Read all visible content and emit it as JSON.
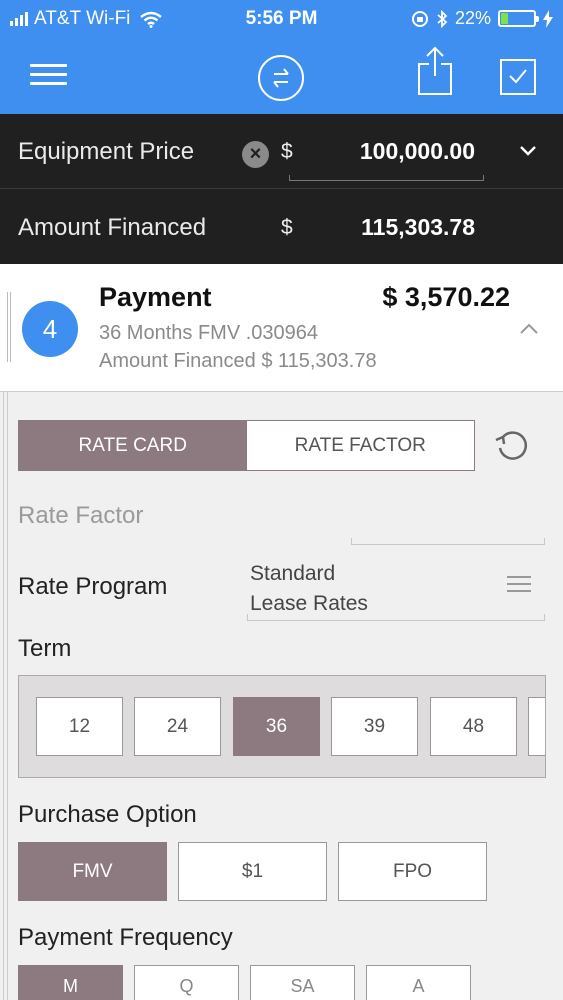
{
  "status_bar": {
    "carrier": "AT&T Wi-Fi",
    "time": "5:56 PM",
    "battery": "22%",
    "battery_level": 0.22
  },
  "header": {
    "equipment_price_label": "Equipment Price",
    "equipment_price_currency": "$",
    "equipment_price_value": "100,000.00",
    "amount_financed_label": "Amount Financed",
    "amount_financed_currency": "$",
    "amount_financed_value": "115,303.78"
  },
  "payment": {
    "step": "4",
    "title": "Payment",
    "amount": "$ 3,570.22",
    "subtitle1": "36 Months FMV .030964",
    "subtitle2": "Amount Financed $ 115,303.78"
  },
  "rate_toggle": {
    "rate_card": "RATE CARD",
    "rate_factor": "RATE FACTOR",
    "selected": "RATE CARD"
  },
  "rate_factor": {
    "placeholder": "Rate Factor"
  },
  "rate_program": {
    "label": "Rate Program",
    "value_line1": "Standard",
    "value_line2": "Lease Rates"
  },
  "term": {
    "label": "Term",
    "options": [
      "12",
      "24",
      "36",
      "39",
      "48"
    ],
    "selected": "36"
  },
  "purchase_option": {
    "label": "Purchase Option",
    "options": [
      "FMV",
      "$1",
      "FPO"
    ],
    "selected": "FMV"
  },
  "payment_frequency": {
    "label": "Payment Frequency",
    "options": [
      "M",
      "Q",
      "SA",
      "A"
    ],
    "selected": "M"
  },
  "colors": {
    "primary_blue": "#3e8ff0",
    "dark_header": "#202020",
    "selected_mauve": "#8c7a80"
  }
}
